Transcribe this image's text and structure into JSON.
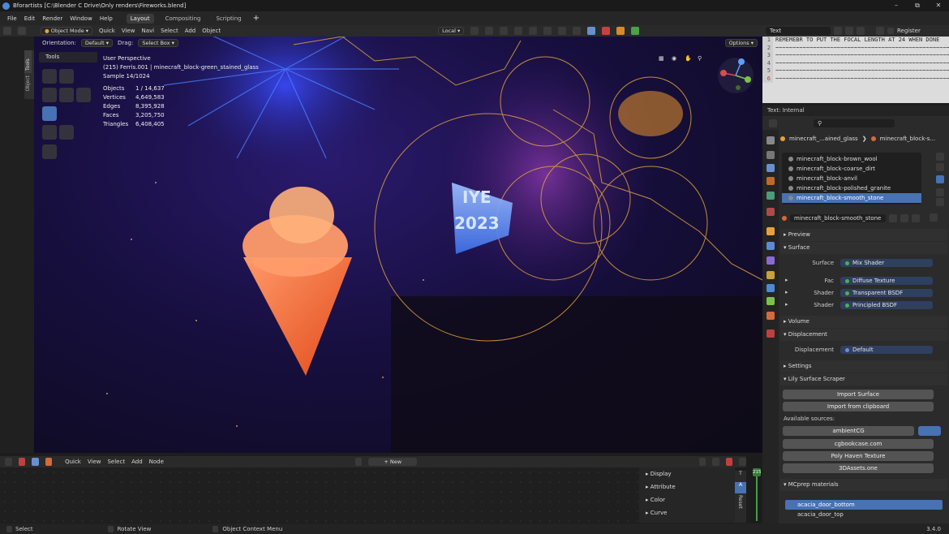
{
  "window": {
    "title": "Bforartists [C:\\Blender C Drive\\Only renders\\Fireworks.blend]"
  },
  "menubar": {
    "items": [
      "File",
      "Edit",
      "Render",
      "Window",
      "Help"
    ],
    "tabs": [
      "Layout",
      "Compositing",
      "Scripting"
    ],
    "add": "+"
  },
  "viewport_header": {
    "mode": "Object Mode",
    "menus": [
      "Quick",
      "View",
      "Navi",
      "Select",
      "Add",
      "Object"
    ],
    "transform_space": "Local"
  },
  "viewport_header2": {
    "orientation_label": "Orientation:",
    "orientation_value": "Default",
    "drag_label": "Drag:",
    "drag_value": "Select Box",
    "options": "Options"
  },
  "tools_panel": {
    "title": "Tools",
    "side_tabs": [
      "Tools",
      "Object"
    ]
  },
  "stats": {
    "view": "User Perspective",
    "object_line": "(215) Ferris.001 | minecraft_block-green_stained_glass",
    "sample": "Sample 14/1024",
    "rows": [
      {
        "k": "Objects",
        "v": "1 / 14,637"
      },
      {
        "k": "Vertices",
        "v": "4,649,583"
      },
      {
        "k": "Edges",
        "v": "8,395,928"
      },
      {
        "k": "Faces",
        "v": "3,205,750"
      },
      {
        "k": "Triangles",
        "v": "6,408,405"
      }
    ]
  },
  "scene_text": {
    "top": "IYE",
    "bottom": "2023"
  },
  "text_editor": {
    "header_label": "Text",
    "register": "Register",
    "lines": [
      {
        "n": "1",
        "t": "REMEMEBR TO PUT THE FOCAL LENGTH AT 24 WHEN DONE"
      },
      {
        "n": "2",
        "t": "~~~~~~~~~~~~~~~~~~~~~~~~~~~~~~~~~~~~~~~~~~~~~~~~~~~"
      },
      {
        "n": "3",
        "t": "~~~~~~~~~~~~~~~~~~~~~~~~~~~~~~~~~~~~~~~~~~~~~~~~~~~"
      },
      {
        "n": "4",
        "t": "~~~~~~~~~~~~~~~~~~~~~~~~~~~~~~~~~~~~~~~~~~~~~~~~~~~"
      },
      {
        "n": "5",
        "t": "~~~~~~~~~~~~~~~~~~~~~~~~~~~~~~~~~~~~~~~~~~~~~~~~~~~"
      },
      {
        "n": "6",
        "t": "~~~~~~~~~~~~~~~~~~~~~~~~~~~~~~~~~~~~~~~~~~~~~~~~~~~"
      }
    ],
    "status": "Text: Internal"
  },
  "properties": {
    "breadcrumb": {
      "object": "minecraft_...ained_glass",
      "material": "minecraft_block-s..."
    },
    "materials": [
      {
        "name": "minecraft_block-brown_wool",
        "sel": false
      },
      {
        "name": "minecraft_block-coarse_dirt",
        "sel": false
      },
      {
        "name": "minecraft_block-anvil",
        "sel": false
      },
      {
        "name": "minecraft_block-polished_granite",
        "sel": false
      },
      {
        "name": "minecraft_block-smooth_stone",
        "sel": true
      }
    ],
    "active_material": "minecraft_block-smooth_stone",
    "sections": {
      "preview": "Preview",
      "surface": "Surface",
      "volume": "Volume",
      "displacement": "Displacement",
      "settings": "Settings",
      "lily": "Lily Surface Scraper",
      "mcprep": "MCprep materials"
    },
    "surface_rows": [
      {
        "label": "Surface",
        "value": "Mix Shader"
      },
      {
        "label": "Fac",
        "value": "Diffuse Texture"
      },
      {
        "label": "Shader",
        "value": "Transparent BSDF"
      },
      {
        "label": "Shader",
        "value": "Principled BSDF"
      }
    ],
    "displacement_row": {
      "label": "Displacement",
      "value": "Default"
    },
    "lily_buttons": [
      "Import Surface",
      "Import from clipboard"
    ],
    "available_sources_label": "Available sources:",
    "sources": [
      "ambientCG",
      "cgbookcase.com",
      "Poly Haven Texture",
      "3DAssets.one"
    ],
    "mcprep_items": [
      {
        "name": "acacia_door_bottom",
        "sel": true
      },
      {
        "name": "acacia_door_top",
        "sel": false
      }
    ]
  },
  "node_editor": {
    "menus": [
      "Quick",
      "View",
      "Select",
      "Add",
      "Node"
    ],
    "new_button": "New",
    "panel_items": [
      "Display",
      "Attribute",
      "Color",
      "Curve"
    ],
    "side_tabs": [
      "T",
      "A",
      "Reset"
    ]
  },
  "timeline": {
    "frame": "215"
  },
  "statusbar": {
    "items": [
      "Select",
      "Rotate View",
      "Object Context Menu"
    ],
    "version": "3.4.0"
  }
}
